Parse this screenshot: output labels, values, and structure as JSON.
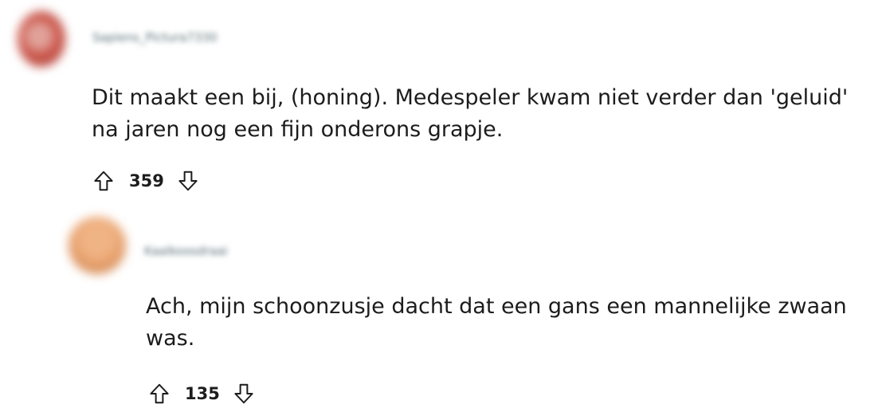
{
  "comments": [
    {
      "username": "Sapiens_Pictura7330",
      "text": "Dit maakt een bij, (honing). Medespeler kwam niet verder dan 'geluid' na jaren nog een fijn onderons grapje.",
      "score": "359",
      "upvote_icon": "arrow-up-outline-icon",
      "downvote_icon": "arrow-down-outline-icon"
    },
    {
      "username": "Kaalkoosdraai",
      "text": "Ach, mijn schoonzusje dacht dat een gans een mannelijke zwaan was.",
      "score": "135",
      "upvote_icon": "arrow-up-outline-icon",
      "downvote_icon": "arrow-down-outline-icon"
    }
  ],
  "colors": {
    "text": "#1c1c1c",
    "username": "#576f76",
    "background": "#ffffff"
  }
}
